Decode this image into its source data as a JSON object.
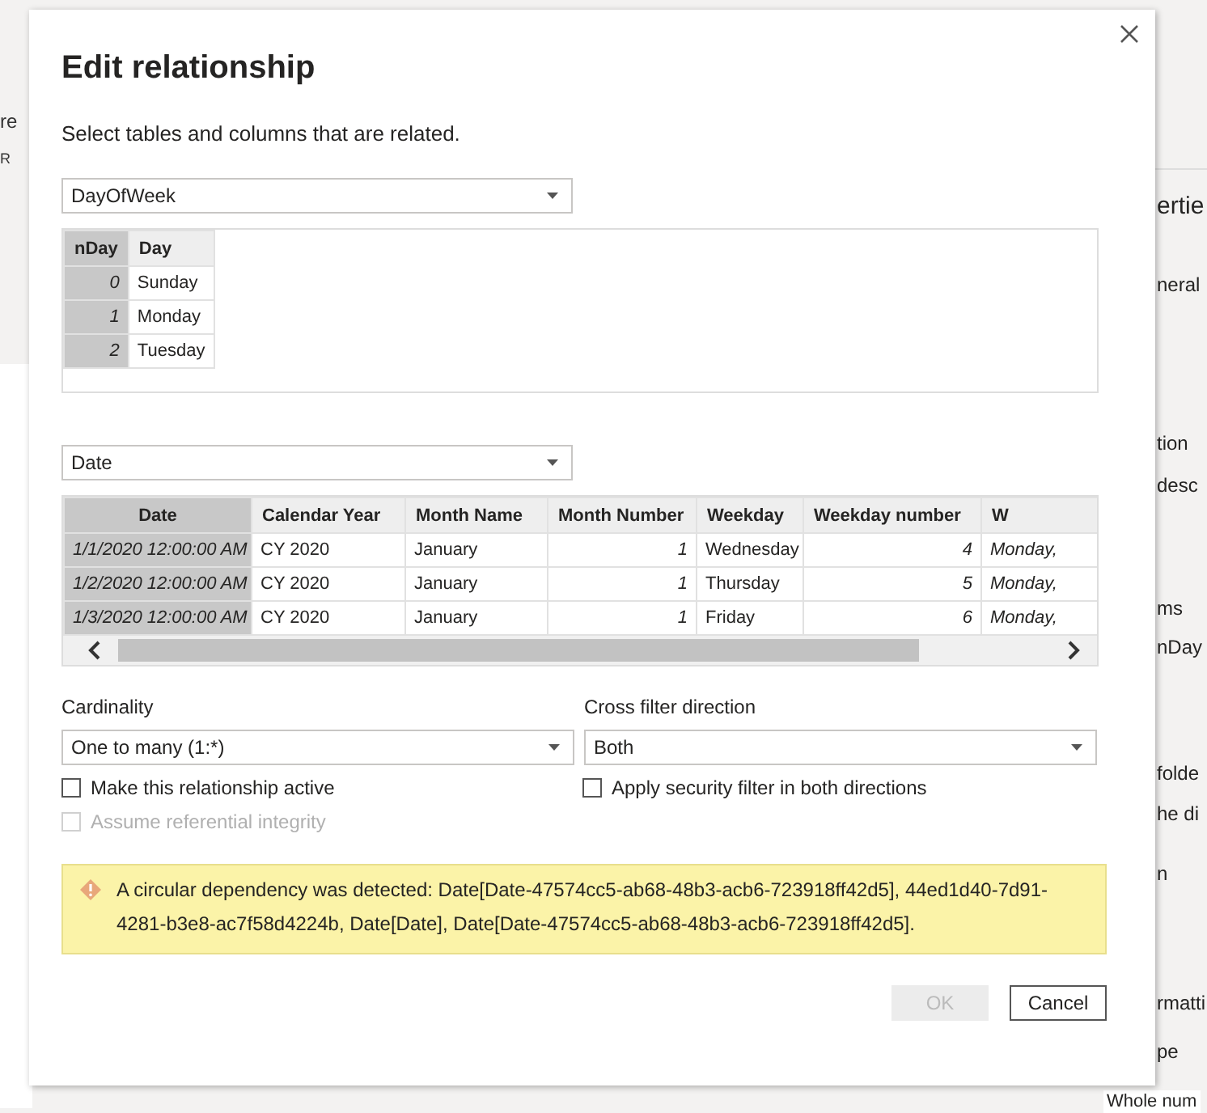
{
  "background": {
    "left_texts": [
      "re",
      "R"
    ],
    "right_panel": [
      "ertie",
      "neral",
      "tion",
      "desc",
      "ms",
      "nDay",
      "folde",
      "he di",
      "n",
      "rmatti",
      "pe",
      "Whole num"
    ]
  },
  "dialog": {
    "title": "Edit relationship",
    "subtitle": "Select tables and columns that are related.",
    "table_1": {
      "dropdown": "DayOfWeek",
      "columns": [
        {
          "label": "nDay",
          "key": true
        },
        {
          "label": "Day",
          "key": false
        }
      ],
      "rows": [
        [
          "0",
          "Sunday"
        ],
        [
          "1",
          "Monday"
        ],
        [
          "2",
          "Tuesday"
        ]
      ]
    },
    "table_2": {
      "dropdown": "Date",
      "columns": [
        {
          "label": "Date",
          "key": true,
          "numeric": false,
          "italic": true
        },
        {
          "label": "Calendar Year",
          "key": false,
          "numeric": false,
          "italic": false
        },
        {
          "label": "Month Name",
          "key": false,
          "numeric": false,
          "italic": false
        },
        {
          "label": "Month Number",
          "key": false,
          "numeric": true,
          "italic": true
        },
        {
          "label": "Weekday",
          "key": false,
          "numeric": false,
          "italic": false
        },
        {
          "label": "Weekday number",
          "key": false,
          "numeric": true,
          "italic": true
        },
        {
          "label": "W",
          "key": false,
          "numeric": false,
          "italic": true
        }
      ],
      "rows": [
        [
          "1/1/2020 12:00:00 AM",
          "CY 2020",
          "January",
          "1",
          "Wednesday",
          "4",
          "Monday,"
        ],
        [
          "1/2/2020 12:00:00 AM",
          "CY 2020",
          "January",
          "1",
          "Thursday",
          "5",
          "Monday,"
        ],
        [
          "1/3/2020 12:00:00 AM",
          "CY 2020",
          "January",
          "1",
          "Friday",
          "6",
          "Monday,"
        ]
      ]
    },
    "cardinality": {
      "label": "Cardinality",
      "value": "One to many (1:*)"
    },
    "cross_filter": {
      "label": "Cross filter direction",
      "value": "Both"
    },
    "options": [
      {
        "label": "Make this relationship active",
        "checked": false,
        "disabled": false
      },
      {
        "label": "Apply security filter in both directions",
        "checked": false,
        "disabled": false
      },
      {
        "label": "Assume referential integrity",
        "checked": false,
        "disabled": true
      }
    ],
    "warning": "A circular dependency was detected: Date[Date-47574cc5-ab68-48b3-acb6-723918ff42d5], 44ed1d40-7d91-4281-b3e8-ac7f58d4224b, Date[Date], Date[Date-47574cc5-ab68-48b3-acb6-723918ff42d5].",
    "buttons": [
      {
        "label": "OK",
        "disabled": true
      },
      {
        "label": "Cancel",
        "disabled": false
      }
    ]
  }
}
